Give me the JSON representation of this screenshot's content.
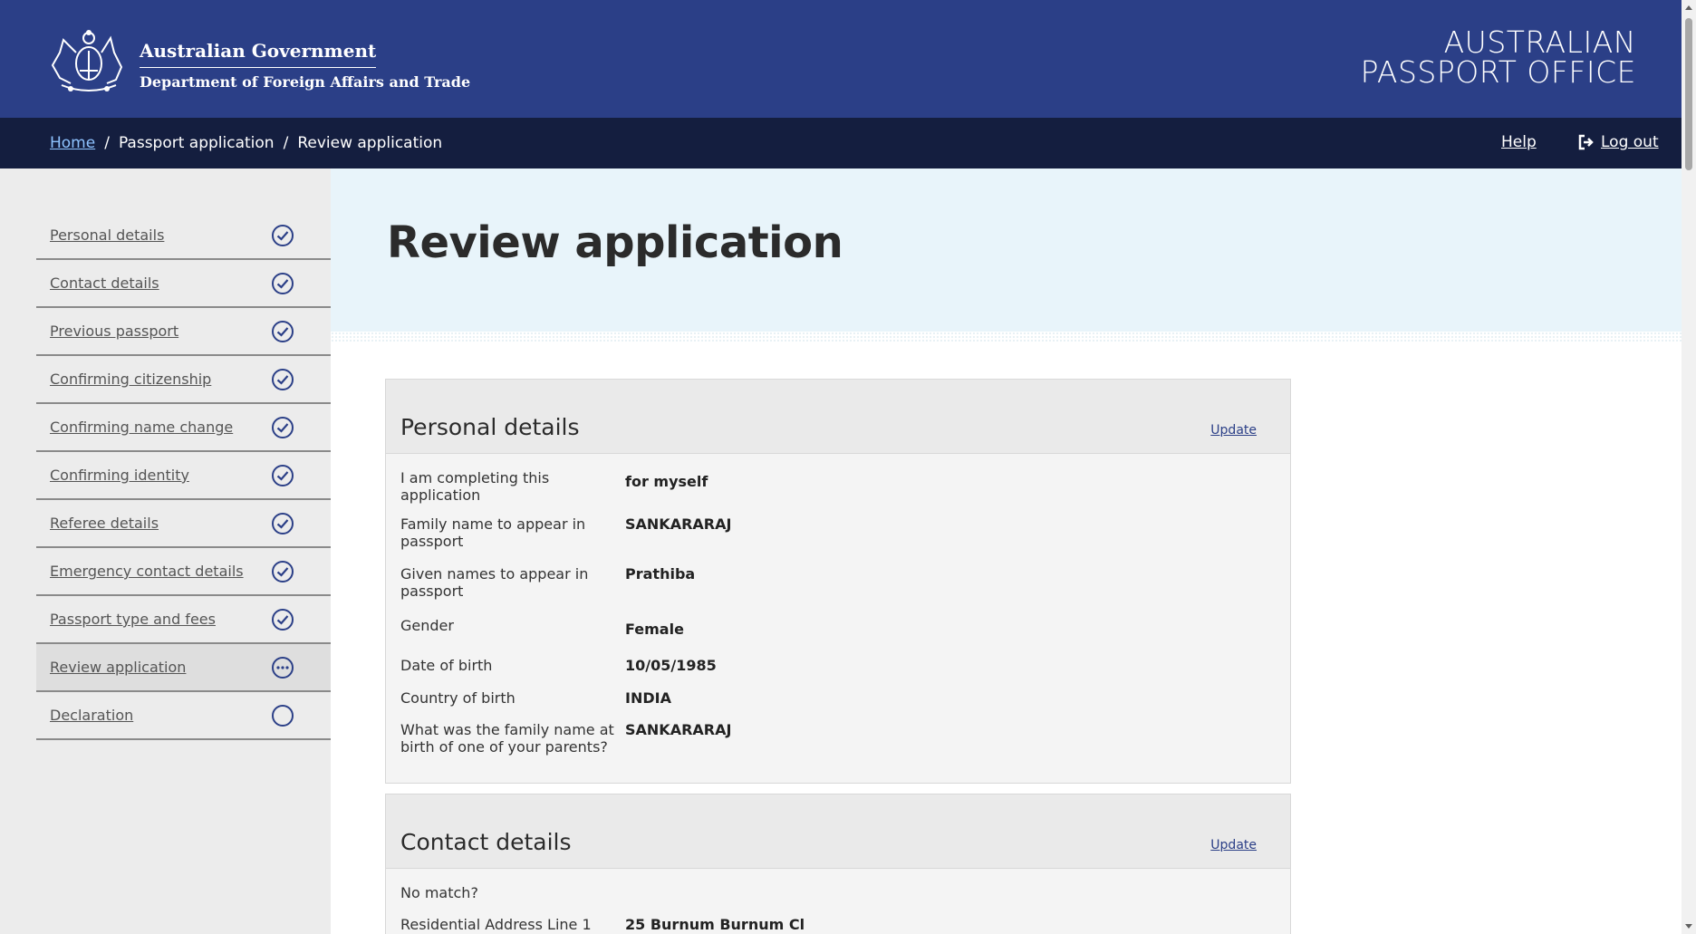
{
  "header": {
    "gov_title": "Australian Government",
    "gov_dept": "Department of Foreign Affairs and Trade",
    "office_line1": "AUSTRALIAN",
    "office_line2": "PASSPORT OFFICE"
  },
  "nav": {
    "breadcrumbs": [
      "Home",
      "Passport application",
      "Review application"
    ],
    "separator": "/",
    "help": "Help",
    "logout": "Log out"
  },
  "sidebar": {
    "items": [
      {
        "label": "Personal details",
        "status": "complete"
      },
      {
        "label": "Contact details",
        "status": "complete"
      },
      {
        "label": "Previous passport",
        "status": "complete"
      },
      {
        "label": "Confirming citizenship",
        "status": "complete"
      },
      {
        "label": "Confirming name change",
        "status": "complete"
      },
      {
        "label": "Confirming identity",
        "status": "complete"
      },
      {
        "label": "Referee details",
        "status": "complete"
      },
      {
        "label": "Emergency contact details",
        "status": "complete"
      },
      {
        "label": "Passport type and fees",
        "status": "complete"
      },
      {
        "label": "Review application",
        "status": "in-progress"
      },
      {
        "label": "Declaration",
        "status": "not-started"
      }
    ]
  },
  "main": {
    "title": "Review application",
    "personal": {
      "title": "Personal details",
      "update": "Update",
      "rows": [
        {
          "label": "I am completing this application",
          "value": "for myself"
        },
        {
          "label": "Family name to appear in passport",
          "value": "SANKARARAJ"
        },
        {
          "label": "Given names to appear in passport",
          "value": "Prathiba"
        },
        {
          "label": "Gender",
          "value": "Female"
        },
        {
          "label": "Date of birth",
          "value": "10/05/1985"
        },
        {
          "label": "Country of birth",
          "value": "INDIA"
        },
        {
          "label": "What was the family name at birth of one of your parents?",
          "value": "SANKARARAJ"
        }
      ]
    },
    "contact": {
      "title": "Contact details",
      "update": "Update",
      "rows": [
        {
          "label": "No match?",
          "value": ""
        },
        {
          "label": "Residential Address Line 1",
          "value": "25 Burnum Burnum Cl"
        }
      ]
    }
  },
  "colors": {
    "header_blue": "#2b3f87",
    "nav_dark": "#141e3f",
    "hero_bg": "#e8f4fa",
    "icon_blue": "#2b3f87"
  }
}
